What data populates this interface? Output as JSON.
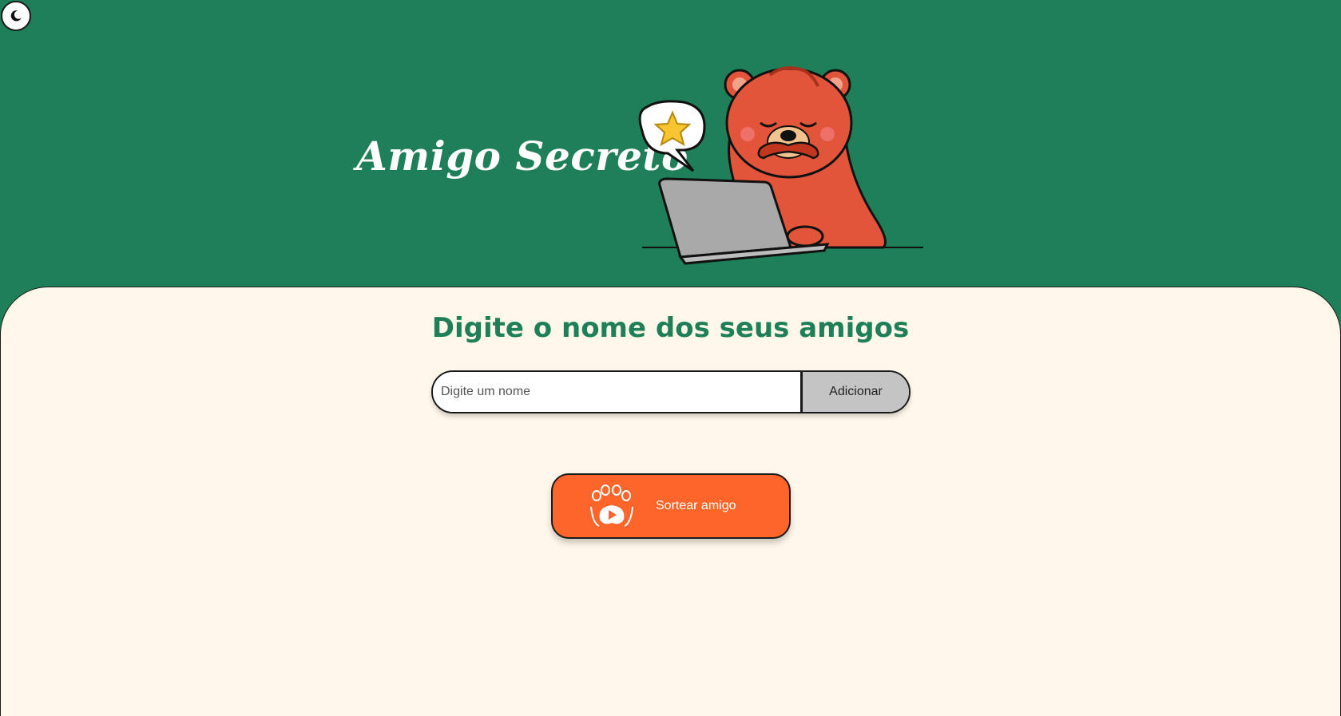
{
  "header": {
    "title": "Amigo Secreto",
    "theme_toggle_icon": "moon-icon",
    "hero_image": "bear-with-laptop-illustration"
  },
  "main": {
    "heading": "Digite o nome dos seus amigos",
    "name_input": {
      "placeholder": "Digite um nome",
      "value": ""
    },
    "add_button_label": "Adicionar",
    "draw_button": {
      "label": "Sortear amigo",
      "icon": "paw-play-icon"
    }
  },
  "colors": {
    "brand_green": "#1f7f58",
    "background_cream": "#fff8ea",
    "accent_orange": "#fe652b",
    "button_gray": "#c4c4c4"
  }
}
